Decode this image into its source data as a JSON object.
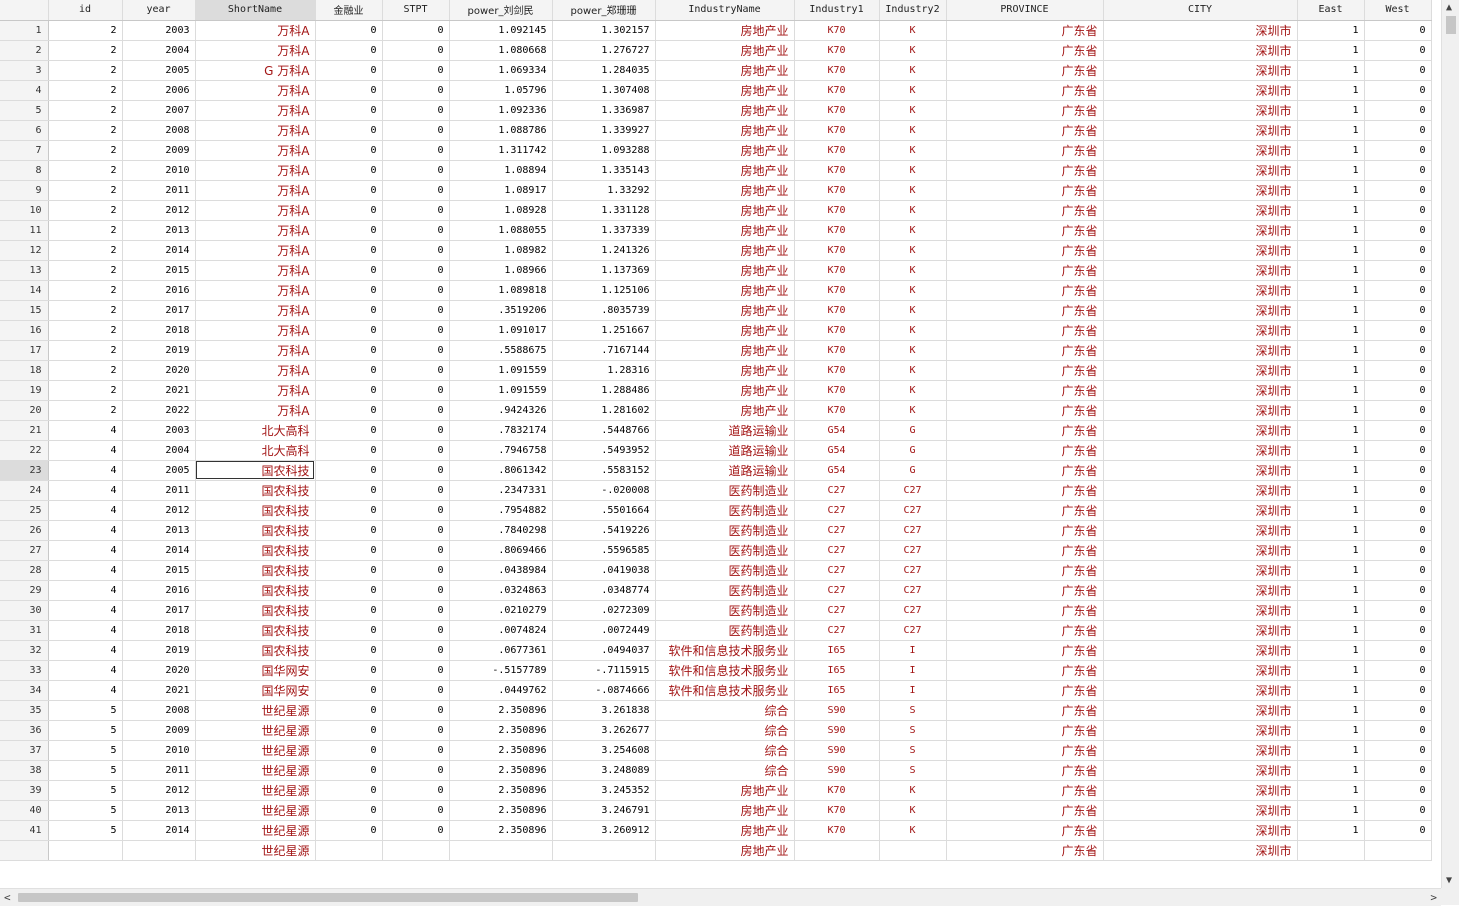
{
  "columns": [
    {
      "key": "id",
      "label": "id",
      "w": 74,
      "type": "num"
    },
    {
      "key": "year",
      "label": "year",
      "w": 73,
      "type": "num"
    },
    {
      "key": "ShortName",
      "label": "ShortName",
      "w": 120,
      "type": "cn",
      "selected": true
    },
    {
      "key": "jry",
      "label": "金融业",
      "w": 67,
      "type": "num"
    },
    {
      "key": "STPT",
      "label": "STPT",
      "w": 67,
      "type": "num"
    },
    {
      "key": "p1",
      "label": "power_刘剑民",
      "w": 103,
      "type": "num"
    },
    {
      "key": "p2",
      "label": "power_郑珊珊",
      "w": 103,
      "type": "num"
    },
    {
      "key": "IndustryName",
      "label": "IndustryName",
      "w": 139,
      "type": "cn"
    },
    {
      "key": "Industry1",
      "label": "Industry1",
      "w": 85,
      "type": "code"
    },
    {
      "key": "Industry2",
      "label": "Industry2",
      "w": 67,
      "type": "code"
    },
    {
      "key": "PROVINCE",
      "label": "PROVINCE",
      "w": 157,
      "type": "cn"
    },
    {
      "key": "CITY",
      "label": "CITY",
      "w": 194,
      "type": "cn"
    },
    {
      "key": "East",
      "label": "East",
      "w": 67,
      "type": "num"
    },
    {
      "key": "West",
      "label": "West",
      "w": 67,
      "type": "num"
    }
  ],
  "current_cell": {
    "row": 23,
    "col": "ShortName"
  },
  "rows": [
    [
      "1",
      "2",
      "2003",
      "万科A",
      "0",
      "0",
      "1.092145",
      "1.302157",
      "房地产业",
      "K70",
      "K",
      "广东省",
      "深圳市",
      "1",
      "0"
    ],
    [
      "2",
      "2",
      "2004",
      "万科A",
      "0",
      "0",
      "1.080668",
      "1.276727",
      "房地产业",
      "K70",
      "K",
      "广东省",
      "深圳市",
      "1",
      "0"
    ],
    [
      "3",
      "2",
      "2005",
      "G 万科A",
      "0",
      "0",
      "1.069334",
      "1.284035",
      "房地产业",
      "K70",
      "K",
      "广东省",
      "深圳市",
      "1",
      "0"
    ],
    [
      "4",
      "2",
      "2006",
      "万科A",
      "0",
      "0",
      "1.05796",
      "1.307408",
      "房地产业",
      "K70",
      "K",
      "广东省",
      "深圳市",
      "1",
      "0"
    ],
    [
      "5",
      "2",
      "2007",
      "万科A",
      "0",
      "0",
      "1.092336",
      "1.336987",
      "房地产业",
      "K70",
      "K",
      "广东省",
      "深圳市",
      "1",
      "0"
    ],
    [
      "6",
      "2",
      "2008",
      "万科A",
      "0",
      "0",
      "1.088786",
      "1.339927",
      "房地产业",
      "K70",
      "K",
      "广东省",
      "深圳市",
      "1",
      "0"
    ],
    [
      "7",
      "2",
      "2009",
      "万科A",
      "0",
      "0",
      "1.311742",
      "1.093288",
      "房地产业",
      "K70",
      "K",
      "广东省",
      "深圳市",
      "1",
      "0"
    ],
    [
      "8",
      "2",
      "2010",
      "万科A",
      "0",
      "0",
      "1.08894",
      "1.335143",
      "房地产业",
      "K70",
      "K",
      "广东省",
      "深圳市",
      "1",
      "0"
    ],
    [
      "9",
      "2",
      "2011",
      "万科A",
      "0",
      "0",
      "1.08917",
      "1.33292",
      "房地产业",
      "K70",
      "K",
      "广东省",
      "深圳市",
      "1",
      "0"
    ],
    [
      "10",
      "2",
      "2012",
      "万科A",
      "0",
      "0",
      "1.08928",
      "1.331128",
      "房地产业",
      "K70",
      "K",
      "广东省",
      "深圳市",
      "1",
      "0"
    ],
    [
      "11",
      "2",
      "2013",
      "万科A",
      "0",
      "0",
      "1.088055",
      "1.337339",
      "房地产业",
      "K70",
      "K",
      "广东省",
      "深圳市",
      "1",
      "0"
    ],
    [
      "12",
      "2",
      "2014",
      "万科A",
      "0",
      "0",
      "1.08982",
      "1.241326",
      "房地产业",
      "K70",
      "K",
      "广东省",
      "深圳市",
      "1",
      "0"
    ],
    [
      "13",
      "2",
      "2015",
      "万科A",
      "0",
      "0",
      "1.08966",
      "1.137369",
      "房地产业",
      "K70",
      "K",
      "广东省",
      "深圳市",
      "1",
      "0"
    ],
    [
      "14",
      "2",
      "2016",
      "万科A",
      "0",
      "0",
      "1.089818",
      "1.125106",
      "房地产业",
      "K70",
      "K",
      "广东省",
      "深圳市",
      "1",
      "0"
    ],
    [
      "15",
      "2",
      "2017",
      "万科A",
      "0",
      "0",
      ".3519206",
      ".8035739",
      "房地产业",
      "K70",
      "K",
      "广东省",
      "深圳市",
      "1",
      "0"
    ],
    [
      "16",
      "2",
      "2018",
      "万科A",
      "0",
      "0",
      "1.091017",
      "1.251667",
      "房地产业",
      "K70",
      "K",
      "广东省",
      "深圳市",
      "1",
      "0"
    ],
    [
      "17",
      "2",
      "2019",
      "万科A",
      "0",
      "0",
      ".5588675",
      ".7167144",
      "房地产业",
      "K70",
      "K",
      "广东省",
      "深圳市",
      "1",
      "0"
    ],
    [
      "18",
      "2",
      "2020",
      "万科A",
      "0",
      "0",
      "1.091559",
      "1.28316",
      "房地产业",
      "K70",
      "K",
      "广东省",
      "深圳市",
      "1",
      "0"
    ],
    [
      "19",
      "2",
      "2021",
      "万科A",
      "0",
      "0",
      "1.091559",
      "1.288486",
      "房地产业",
      "K70",
      "K",
      "广东省",
      "深圳市",
      "1",
      "0"
    ],
    [
      "20",
      "2",
      "2022",
      "万科A",
      "0",
      "0",
      ".9424326",
      "1.281602",
      "房地产业",
      "K70",
      "K",
      "广东省",
      "深圳市",
      "1",
      "0"
    ],
    [
      "21",
      "4",
      "2003",
      "北大高科",
      "0",
      "0",
      ".7832174",
      ".5448766",
      "道路运输业",
      "G54",
      "G",
      "广东省",
      "深圳市",
      "1",
      "0"
    ],
    [
      "22",
      "4",
      "2004",
      "北大高科",
      "0",
      "0",
      ".7946758",
      ".5493952",
      "道路运输业",
      "G54",
      "G",
      "广东省",
      "深圳市",
      "1",
      "0"
    ],
    [
      "23",
      "4",
      "2005",
      "国农科技",
      "0",
      "0",
      ".8061342",
      ".5583152",
      "道路运输业",
      "G54",
      "G",
      "广东省",
      "深圳市",
      "1",
      "0"
    ],
    [
      "24",
      "4",
      "2011",
      "国农科技",
      "0",
      "0",
      ".2347331",
      "-.020008",
      "医药制造业",
      "C27",
      "C27",
      "广东省",
      "深圳市",
      "1",
      "0"
    ],
    [
      "25",
      "4",
      "2012",
      "国农科技",
      "0",
      "0",
      ".7954882",
      ".5501664",
      "医药制造业",
      "C27",
      "C27",
      "广东省",
      "深圳市",
      "1",
      "0"
    ],
    [
      "26",
      "4",
      "2013",
      "国农科技",
      "0",
      "0",
      ".7840298",
      ".5419226",
      "医药制造业",
      "C27",
      "C27",
      "广东省",
      "深圳市",
      "1",
      "0"
    ],
    [
      "27",
      "4",
      "2014",
      "国农科技",
      "0",
      "0",
      ".8069466",
      ".5596585",
      "医药制造业",
      "C27",
      "C27",
      "广东省",
      "深圳市",
      "1",
      "0"
    ],
    [
      "28",
      "4",
      "2015",
      "国农科技",
      "0",
      "0",
      ".0438984",
      ".0419038",
      "医药制造业",
      "C27",
      "C27",
      "广东省",
      "深圳市",
      "1",
      "0"
    ],
    [
      "29",
      "4",
      "2016",
      "国农科技",
      "0",
      "0",
      ".0324863",
      ".0348774",
      "医药制造业",
      "C27",
      "C27",
      "广东省",
      "深圳市",
      "1",
      "0"
    ],
    [
      "30",
      "4",
      "2017",
      "国农科技",
      "0",
      "0",
      ".0210279",
      ".0272309",
      "医药制造业",
      "C27",
      "C27",
      "广东省",
      "深圳市",
      "1",
      "0"
    ],
    [
      "31",
      "4",
      "2018",
      "国农科技",
      "0",
      "0",
      ".0074824",
      ".0072449",
      "医药制造业",
      "C27",
      "C27",
      "广东省",
      "深圳市",
      "1",
      "0"
    ],
    [
      "32",
      "4",
      "2019",
      "国农科技",
      "0",
      "0",
      ".0677361",
      ".0494037",
      "软件和信息技术服务业",
      "I65",
      "I",
      "广东省",
      "深圳市",
      "1",
      "0"
    ],
    [
      "33",
      "4",
      "2020",
      "国华网安",
      "0",
      "0",
      "-.5157789",
      "-.7115915",
      "软件和信息技术服务业",
      "I65",
      "I",
      "广东省",
      "深圳市",
      "1",
      "0"
    ],
    [
      "34",
      "4",
      "2021",
      "国华网安",
      "0",
      "0",
      ".0449762",
      "-.0874666",
      "软件和信息技术服务业",
      "I65",
      "I",
      "广东省",
      "深圳市",
      "1",
      "0"
    ],
    [
      "35",
      "5",
      "2008",
      "世纪星源",
      "0",
      "0",
      "2.350896",
      "3.261838",
      "综合",
      "S90",
      "S",
      "广东省",
      "深圳市",
      "1",
      "0"
    ],
    [
      "36",
      "5",
      "2009",
      "世纪星源",
      "0",
      "0",
      "2.350896",
      "3.262677",
      "综合",
      "S90",
      "S",
      "广东省",
      "深圳市",
      "1",
      "0"
    ],
    [
      "37",
      "5",
      "2010",
      "世纪星源",
      "0",
      "0",
      "2.350896",
      "3.254608",
      "综合",
      "S90",
      "S",
      "广东省",
      "深圳市",
      "1",
      "0"
    ],
    [
      "38",
      "5",
      "2011",
      "世纪星源",
      "0",
      "0",
      "2.350896",
      "3.248089",
      "综合",
      "S90",
      "S",
      "广东省",
      "深圳市",
      "1",
      "0"
    ],
    [
      "39",
      "5",
      "2012",
      "世纪星源",
      "0",
      "0",
      "2.350896",
      "3.245352",
      "房地产业",
      "K70",
      "K",
      "广东省",
      "深圳市",
      "1",
      "0"
    ],
    [
      "40",
      "5",
      "2013",
      "世纪星源",
      "0",
      "0",
      "2.350896",
      "3.246791",
      "房地产业",
      "K70",
      "K",
      "广东省",
      "深圳市",
      "1",
      "0"
    ],
    [
      "41",
      "5",
      "2014",
      "世纪星源",
      "0",
      "0",
      "2.350896",
      "3.260912",
      "房地产业",
      "K70",
      "K",
      "广东省",
      "深圳市",
      "1",
      "0"
    ]
  ],
  "partial_row": [
    "",
    "",
    "",
    "世纪星源",
    "",
    "",
    "",
    "",
    "房地产业",
    "",
    "",
    "广东省",
    "深圳市",
    "",
    ""
  ],
  "scrollbars": {
    "up_icon": "▲",
    "down_icon": "▼",
    "left_icon": "<",
    "right_icon": ">"
  }
}
